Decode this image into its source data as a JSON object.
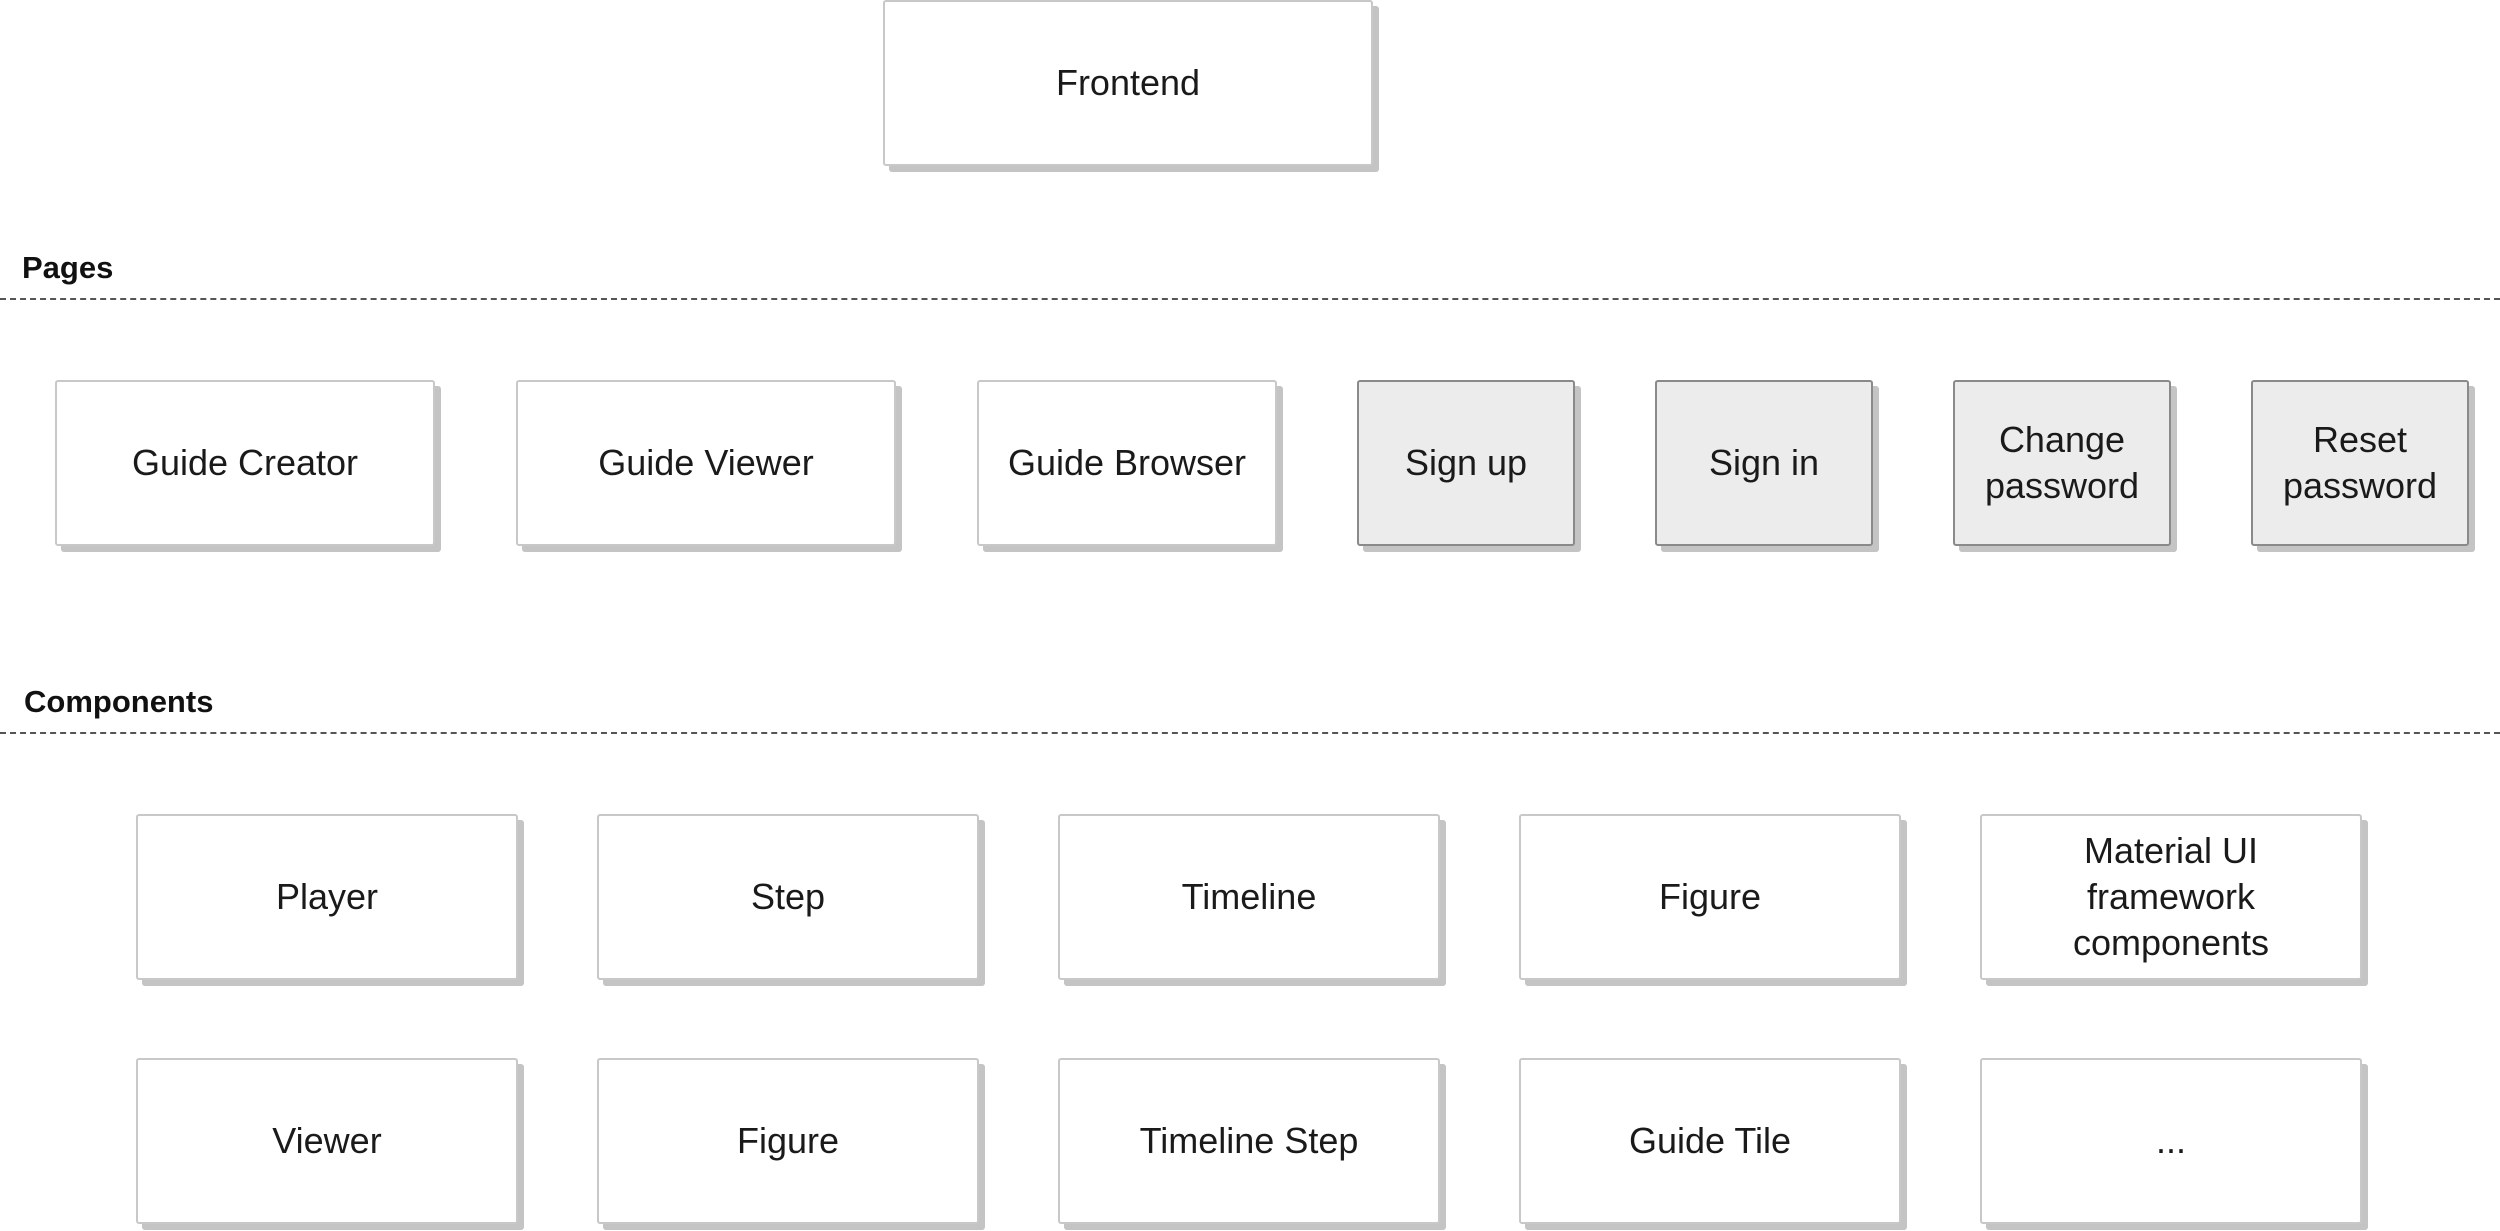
{
  "top": {
    "frontend": "Frontend"
  },
  "sections": {
    "pages_label": "Pages",
    "components_label": "Components"
  },
  "pages": [
    "Guide Creator",
    "Guide Viewer",
    "Guide Browser",
    "Sign up",
    "Sign in",
    "Change\npassword",
    "Reset\npassword"
  ],
  "components_row1": [
    "Player",
    "Step",
    "Timeline",
    "Figure",
    "Material UI\nframework\ncomponents"
  ],
  "components_row2": [
    "Viewer",
    "Figure",
    "Timeline Step",
    "Guide Tile",
    "..."
  ],
  "colors": {
    "box_fill": "#ffffff",
    "box_fill_auth": "#ececec",
    "box_border": "#c8c8c8",
    "box_border_auth": "#8a8a8a",
    "shadow": "#c4c4c4",
    "divider": "#555555"
  }
}
